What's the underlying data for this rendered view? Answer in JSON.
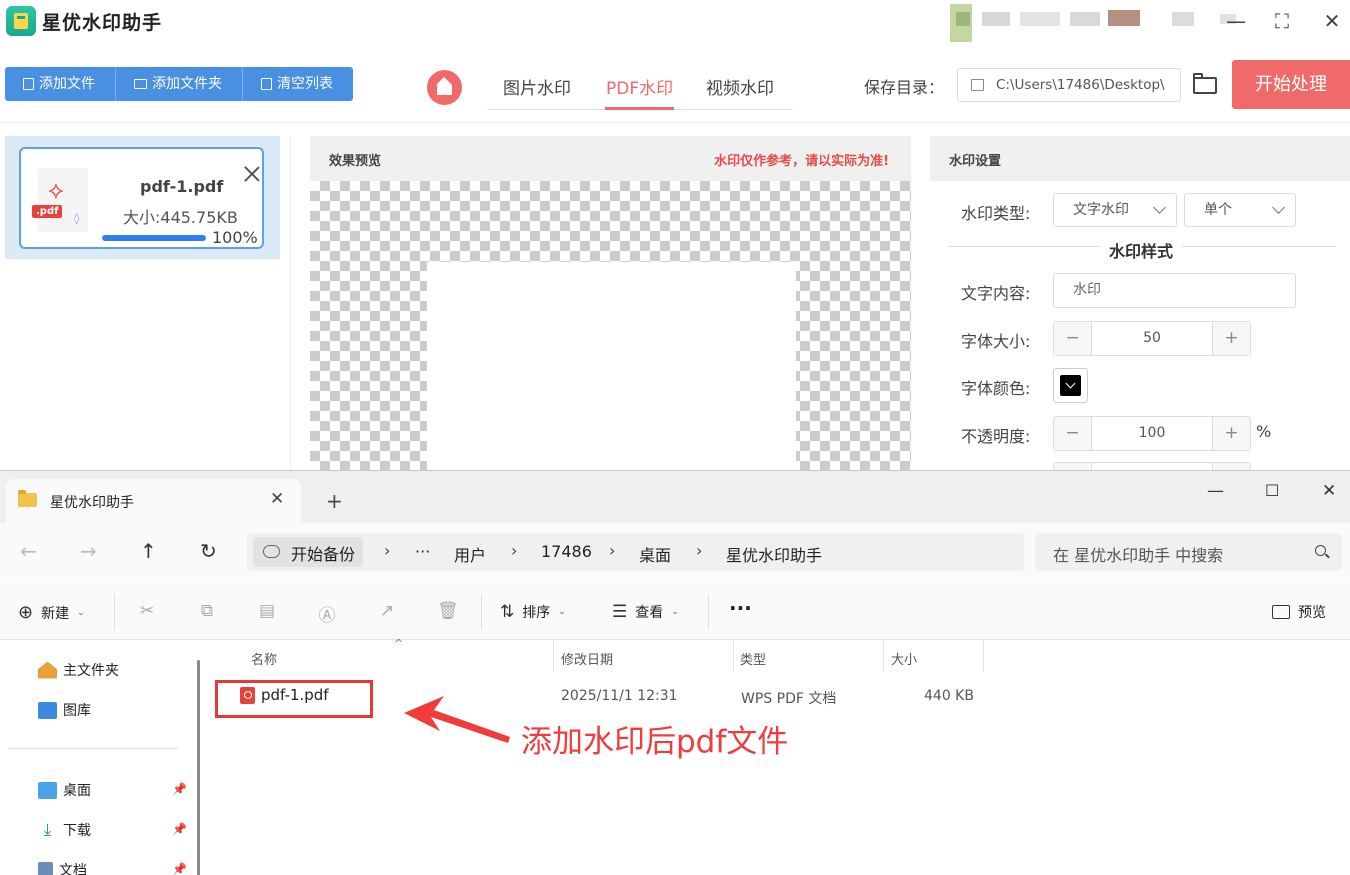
{
  "app": {
    "title": "星优水印助手",
    "toolbar": {
      "add_file": "添加文件",
      "add_folder": "添加文件夹",
      "clear_list": "清空列表"
    },
    "tabs": [
      {
        "label": "图片水印",
        "active": false
      },
      {
        "label": "PDF水印",
        "active": true
      },
      {
        "label": "视频水印",
        "active": false
      }
    ],
    "save_dir": {
      "label": "保存目录：",
      "path": "C:\\Users\\17486\\Desktop\\"
    },
    "start_button": "开始处理",
    "file_list": [
      {
        "name": "pdf-1.pdf",
        "size": "大小:445.75KB",
        "progress": 100,
        "progress_text": "100%",
        "icon_tag": ".pdf"
      }
    ],
    "preview": {
      "title": "效果预览",
      "note": "水印仅作参考，请以实际为准!"
    },
    "settings": {
      "title": "水印设置",
      "type_label": "水印类型:",
      "type_value": "文字水印",
      "mode_value": "单个",
      "style_title": "水印样式",
      "text_label": "文字内容:",
      "text_value": "水印",
      "size_label": "字体大小:",
      "size_value": "50",
      "color_label": "字体颜色:",
      "color_value": "#000000",
      "opacity_label": "不透明度:",
      "opacity_value": "100",
      "opacity_unit": "%",
      "minus": "−",
      "plus": "+"
    },
    "colors": {
      "accent": "#f06a6a",
      "primary": "#4a90e2",
      "progress": "#2d7ff0"
    }
  },
  "explorer": {
    "tab_title": "星优水印助手",
    "tab_close": "✕",
    "new_tab": "+",
    "breadcrumbs": {
      "backup": "开始备份",
      "ellipsis": "···",
      "items": [
        "用户",
        "17486",
        "桌面",
        "星优水印助手"
      ]
    },
    "search_placeholder": "在 星优水印助手 中搜索",
    "commands": {
      "new": "新建",
      "sort": "排序",
      "view": "查看",
      "more": "···",
      "preview": "预览"
    },
    "sidebar": {
      "home": "主文件夹",
      "gallery": "图库",
      "desktop": "桌面",
      "downloads": "下载",
      "documents": "文档"
    },
    "columns": [
      "名称",
      "修改日期",
      "类型",
      "大小"
    ],
    "files": [
      {
        "name": "pdf-1.pdf",
        "modified": "2025/11/1 12:31",
        "type": "WPS PDF 文档",
        "size": "440 KB"
      }
    ]
  },
  "annotation": {
    "text": "添加水印后pdf文件",
    "color": "#f03c3c"
  }
}
